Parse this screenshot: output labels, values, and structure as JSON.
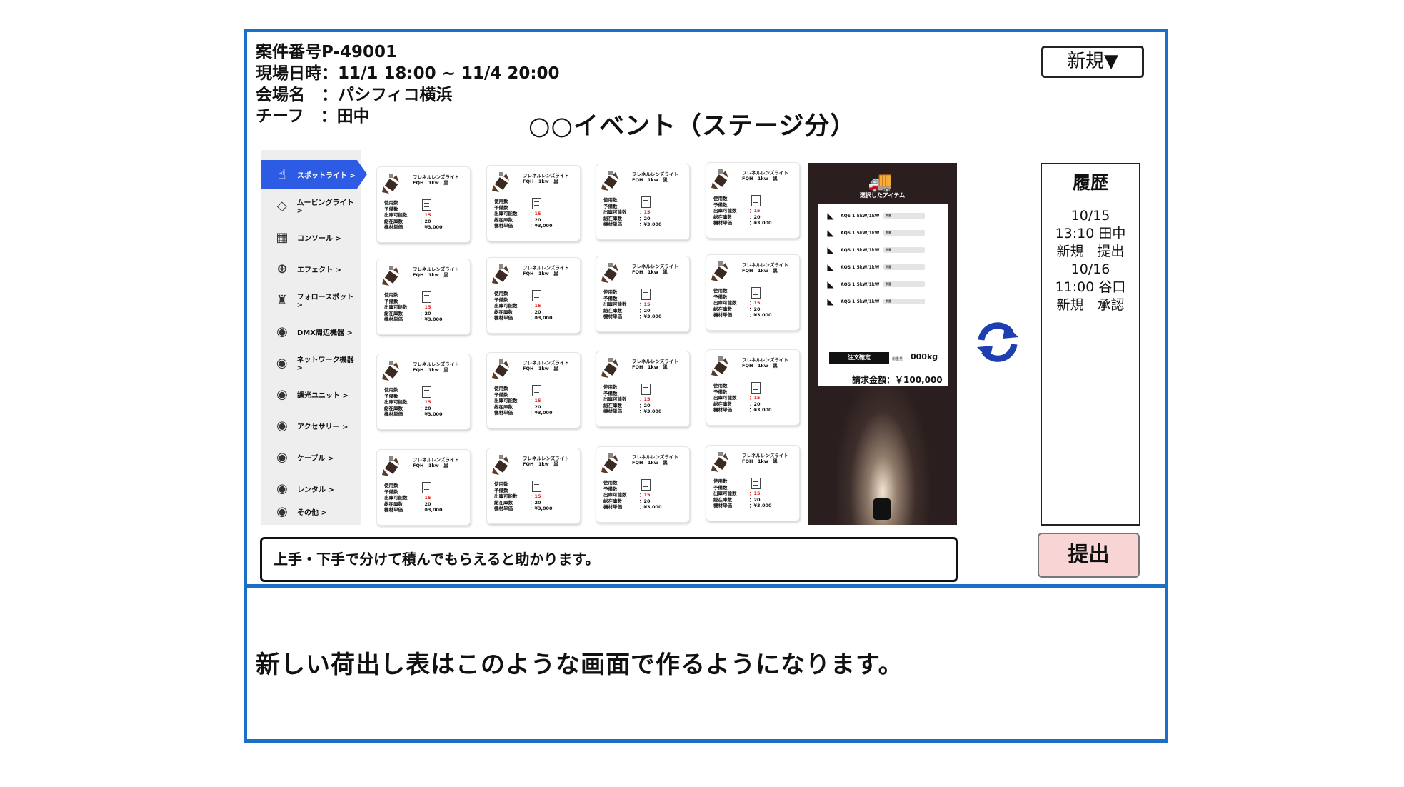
{
  "header": {
    "case_number": "案件番号P-49001",
    "datetime": "現場日時：11/1 18:00 ~ 11/4 20:00",
    "venue": "会場名　：パシフィコ横浜",
    "chief": "チーフ　：田中",
    "event_title": "○○イベント（ステージ分）",
    "new_button": "新規▼"
  },
  "sidebar": {
    "items": [
      {
        "label": "スポットライト >",
        "icon": "spotlight-hand-icon",
        "active": true
      },
      {
        "label": "ムービングライト >",
        "icon": "moving-light-icon"
      },
      {
        "label": "コンソール >",
        "icon": "console-icon"
      },
      {
        "label": "エフェクト >",
        "icon": "effect-globe-icon"
      },
      {
        "label": "フォロースポット >",
        "icon": "follow-spot-icon"
      },
      {
        "label": "DMX周辺機器 >",
        "icon": "dmx-device-icon"
      },
      {
        "label": "ネットワーク機器 >",
        "icon": "network-device-icon"
      },
      {
        "label": "調光ユニット >",
        "icon": "dimmer-unit-icon"
      },
      {
        "label": "アクセサリー >",
        "icon": "accessory-icon"
      },
      {
        "label": "ケーブル >",
        "icon": "cable-icon"
      },
      {
        "label": "レンタル >",
        "icon": "rental-icon"
      },
      {
        "label": "その他 >",
        "icon": "other-icon"
      }
    ]
  },
  "product_card": {
    "title": "フレネルレンズライト\nFQH　1kw　黒",
    "labels": [
      "使用数",
      "予備数",
      "出庫可能数",
      "総在庫数",
      "機材単価"
    ],
    "available": "：15",
    "total_stock": "：20",
    "unit_price": "：¥3,000",
    "rows": 4,
    "cols": 4
  },
  "selection_panel": {
    "title": "選択したアイテム",
    "items": [
      {
        "name": "AQS 1.5kW/1kW",
        "select": "数量"
      },
      {
        "name": "AQS 1.5kW/1kW",
        "select": "数量"
      },
      {
        "name": "AQS 1.5kW/1kW",
        "select": "数量"
      },
      {
        "name": "AQS 1.5kW/1kW",
        "select": "数量"
      },
      {
        "name": "AQS 1.5kW/1kW",
        "select": "数量"
      },
      {
        "name": "AQS 1.5kW/1kW",
        "select": "数量"
      }
    ],
    "confirm_button": "注文確定",
    "weight_label": "総重量",
    "weight": "000kg",
    "total": "請求金額：￥100,000"
  },
  "history": {
    "title": "履歴",
    "entries": [
      "10/15",
      "13:10 田中",
      "新規　提出",
      "10/16",
      "11:00 谷口",
      "新規　承認"
    ]
  },
  "submit_button": "提出",
  "note": "上手・下手で分けて積んでもらえると助かります。",
  "caption": "新しい荷出し表はこのような画面で作るようになります。",
  "colors": {
    "frame": "#1b6fc7",
    "sidebar_active": "#2d5be3",
    "submit_bg": "#f8d4d4",
    "refresh": "#1d3fb0",
    "panel_bg": "#2a1f1e"
  }
}
